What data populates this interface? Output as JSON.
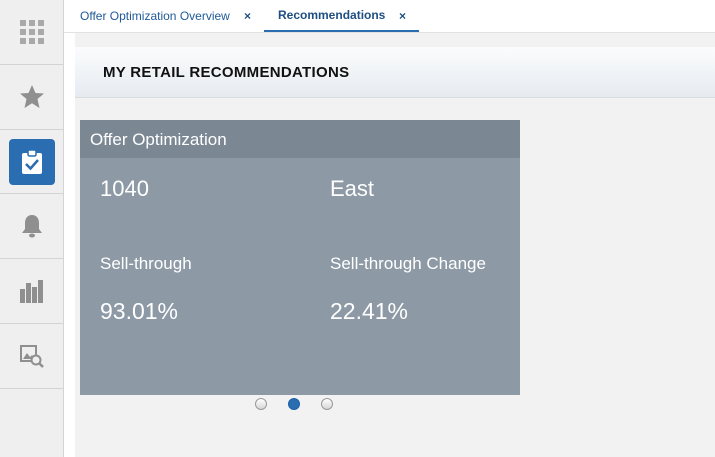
{
  "sidebar": {
    "items": [
      {
        "icon": "grid-icon",
        "active": false
      },
      {
        "icon": "star-icon",
        "active": false
      },
      {
        "icon": "clipboard-check-icon",
        "active": true
      },
      {
        "icon": "bell-icon",
        "active": false
      },
      {
        "icon": "bar-chart-icon",
        "active": false
      },
      {
        "icon": "image-search-icon",
        "active": false
      }
    ],
    "accent_color": "#2a6db0"
  },
  "tabs": [
    {
      "label": "Offer Optimization Overview",
      "close": "×",
      "active": false
    },
    {
      "label": "Recommendations",
      "close": "×",
      "active": true
    }
  ],
  "page": {
    "title": "MY RETAIL RECOMMENDATIONS"
  },
  "card": {
    "title": "Offer Optimization",
    "store_id": "1040",
    "region": "East",
    "sell_through_label": "Sell-through",
    "sell_through_value": "93.01%",
    "sell_through_change_label": "Sell-through Change",
    "sell_through_change_value": "22.41%",
    "background_color": "#8d9aa6"
  },
  "pager": {
    "count": 3,
    "active_index": 1
  }
}
